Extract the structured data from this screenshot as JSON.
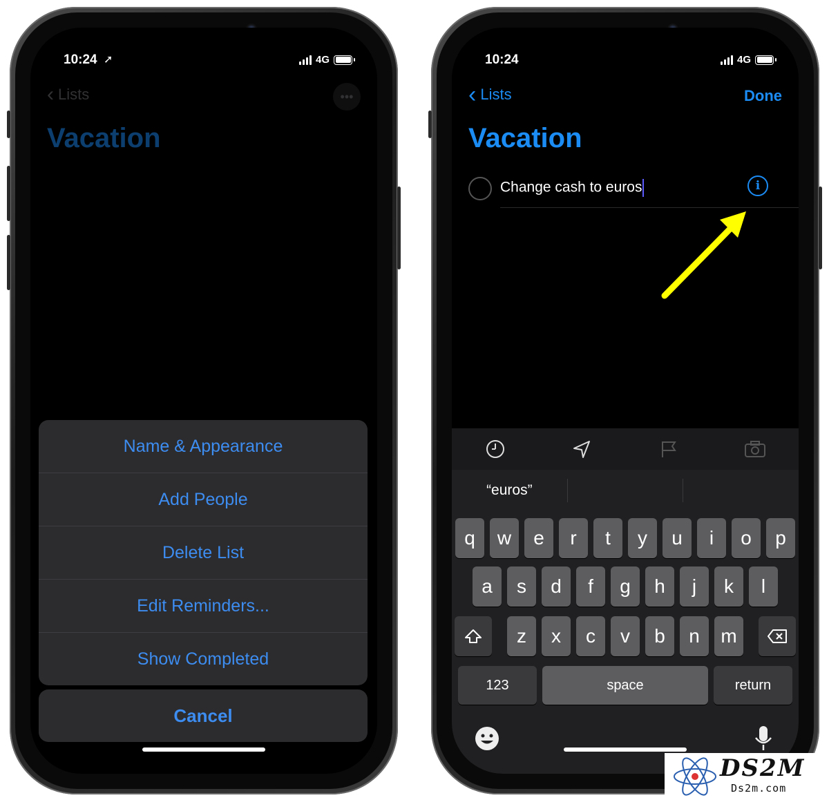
{
  "left_phone": {
    "status": {
      "time": "10:24",
      "network": "4G"
    },
    "nav": {
      "back_label": "Lists"
    },
    "title": "Vacation",
    "action_sheet": {
      "items": [
        "Name & Appearance",
        "Add People",
        "Delete List",
        "Edit Reminders...",
        "Show Completed"
      ],
      "cancel_label": "Cancel"
    }
  },
  "right_phone": {
    "status": {
      "time": "10:24",
      "network": "4G"
    },
    "nav": {
      "back_label": "Lists",
      "done_label": "Done"
    },
    "title": "Vacation",
    "reminder": {
      "text": "Change cash to euros",
      "info_icon": "i"
    },
    "toolbar_icons": [
      "clock-icon",
      "location-icon",
      "flag-icon",
      "camera-icon"
    ],
    "suggestions": [
      "“euros”",
      "",
      ""
    ],
    "keyboard": {
      "row1": [
        "q",
        "w",
        "e",
        "r",
        "t",
        "y",
        "u",
        "i",
        "o",
        "p"
      ],
      "row2": [
        "a",
        "s",
        "d",
        "f",
        "g",
        "h",
        "j",
        "k",
        "l"
      ],
      "row3": [
        "z",
        "x",
        "c",
        "v",
        "b",
        "n",
        "m"
      ],
      "numbers_label": "123",
      "space_label": "space",
      "return_label": "return"
    }
  },
  "watermark": {
    "brand": "DS2M",
    "domain": "Ds2m.com"
  },
  "colors": {
    "accent": "#1c8cf5",
    "sheet_text": "#3d8cf0",
    "arrow": "#ffff00"
  }
}
